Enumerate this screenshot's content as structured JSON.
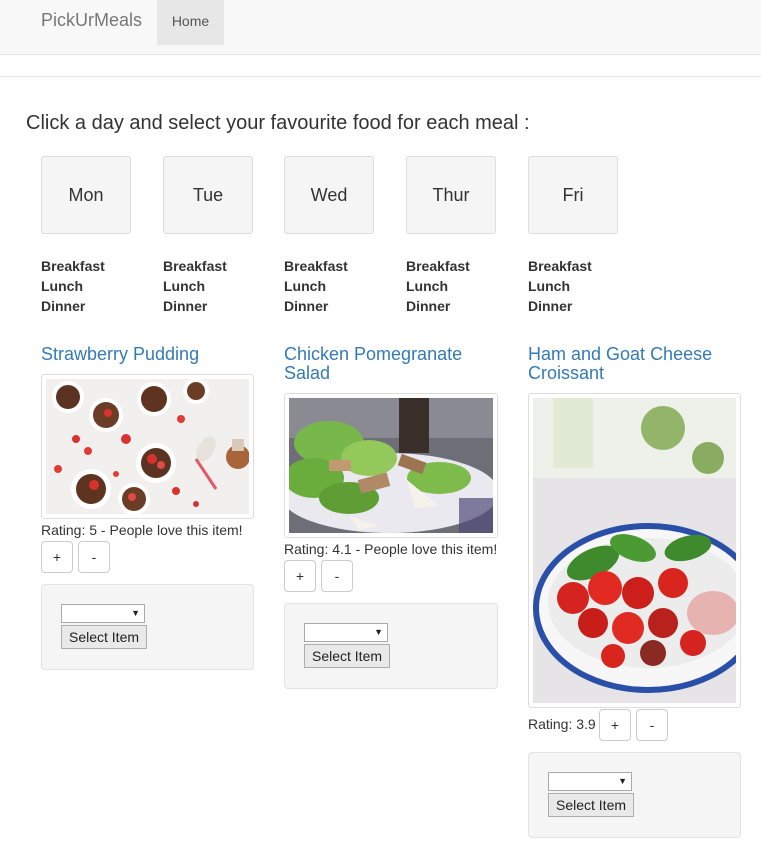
{
  "navbar": {
    "brand": "PickUrMeals",
    "home_label": "Home"
  },
  "instructions": "Click a day and select your favourite food for each meal :",
  "days": [
    {
      "label": "Mon",
      "meals": [
        "Breakfast",
        "Lunch",
        "Dinner"
      ]
    },
    {
      "label": "Tue",
      "meals": [
        "Breakfast",
        "Lunch",
        "Dinner"
      ]
    },
    {
      "label": "Wed",
      "meals": [
        "Breakfast",
        "Lunch",
        "Dinner"
      ]
    },
    {
      "label": "Thur",
      "meals": [
        "Breakfast",
        "Lunch",
        "Dinner"
      ]
    },
    {
      "label": "Fri",
      "meals": [
        "Breakfast",
        "Lunch",
        "Dinner"
      ]
    }
  ],
  "foods": [
    {
      "title_line1": "Strawberry Pudding",
      "title_line2": "",
      "rating_text": "Rating: 5 - People love this item!",
      "plus": "+",
      "minus": "-",
      "select_value": "",
      "select_button": "Select Item"
    },
    {
      "title_line1": "Chicken Pomegranate",
      "title_line2": "Salad",
      "rating_text": "Rating: 4.1 - People love this item!",
      "plus": "+",
      "minus": "-",
      "select_value": "",
      "select_button": "Select Item"
    },
    {
      "title_line1": "Ham and Goat Cheese",
      "title_line2": "Croissant",
      "rating_text": "Rating: 3.9",
      "plus": "+",
      "minus": "-",
      "select_value": "",
      "select_button": "Select Item"
    }
  ],
  "colors": {
    "link": "#337ab7",
    "navbar_bg": "#f8f8f8",
    "panel_bg": "#f5f5f5"
  }
}
